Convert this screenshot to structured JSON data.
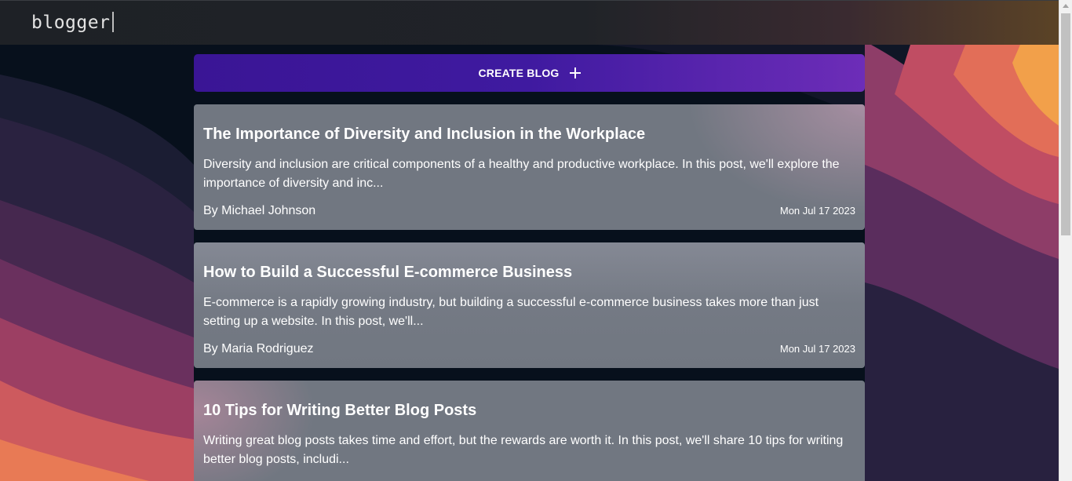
{
  "app": {
    "logo_text": "blogger"
  },
  "actions": {
    "create_blog_label": "CREATE BLOG"
  },
  "posts": [
    {
      "title": "The Importance of Diversity and Inclusion in the Workplace",
      "excerpt": "Diversity and inclusion are critical components of a healthy and productive workplace. In this post, we'll explore the importance of diversity and inc...",
      "author": "By Michael Johnson",
      "date": "Mon Jul 17 2023"
    },
    {
      "title": "How to Build a Successful E-commerce Business",
      "excerpt": "E-commerce is a rapidly growing industry, but building a successful e-commerce business takes more than just setting up a website. In this post, we'll...",
      "author": "By Maria Rodriguez",
      "date": "Mon Jul 17 2023"
    },
    {
      "title": "10 Tips for Writing Better Blog Posts",
      "excerpt": "Writing great blog posts takes time and effort, but the rewards are worth it. In this post, we'll share 10 tips for writing better blog posts, includi..."
    }
  ],
  "icons": {
    "create": "plus-icon"
  },
  "colors": {
    "header_bg": "#1e2126",
    "create_button_start": "#3a1595",
    "create_button_end": "#6d2db8",
    "card_bg": "#8c919b",
    "wave_orange": "#f2a04a",
    "wave_coral": "#e26e58",
    "wave_rose": "#c04d63",
    "wave_plum": "#8e3d68",
    "wave_purple": "#5a2d5d",
    "wave_navy": "#2a2240"
  }
}
